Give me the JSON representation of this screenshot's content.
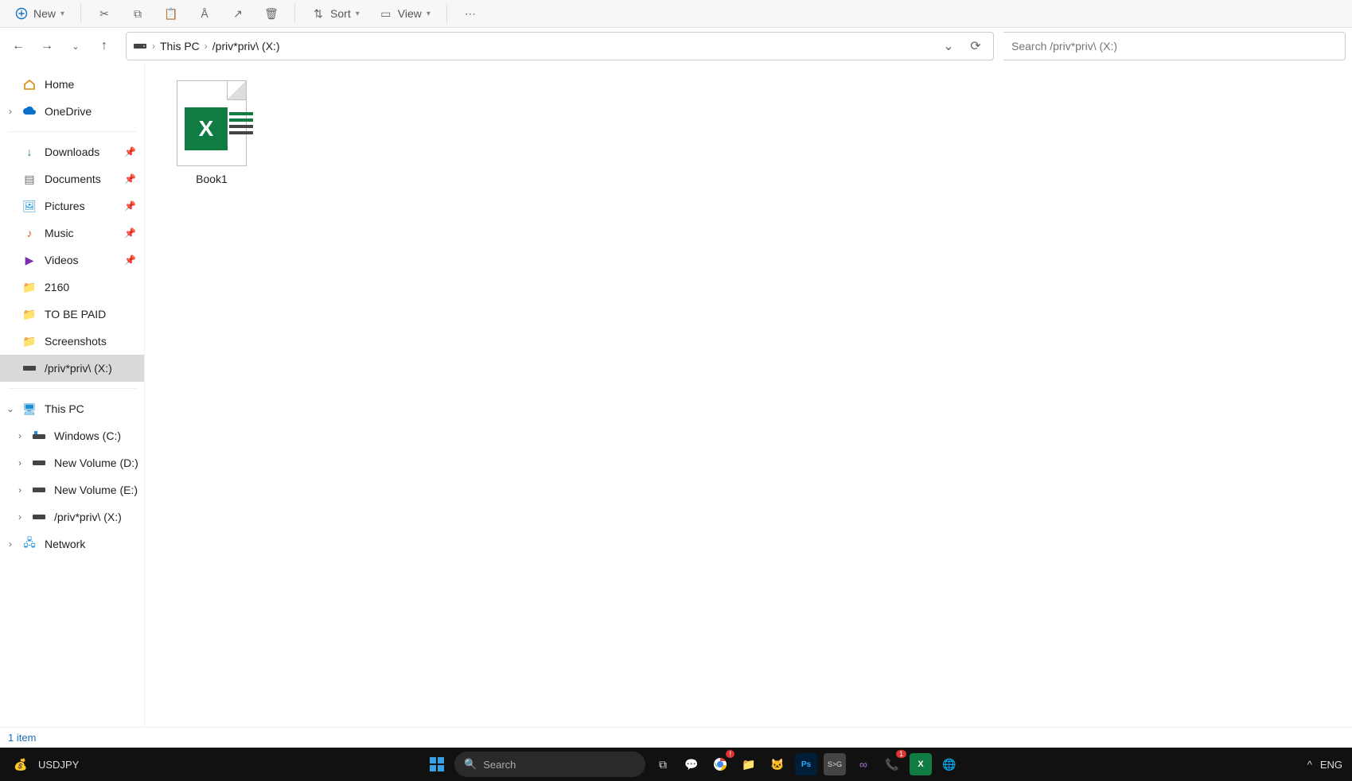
{
  "toolbar": {
    "new_label": "New",
    "sort_label": "Sort",
    "view_label": "View"
  },
  "nav": {
    "breadcrumb": [
      "This PC",
      "/priv*priv\\ (X:)"
    ],
    "search_placeholder": "Search /priv*priv\\ (X:)"
  },
  "sidebar": {
    "home": "Home",
    "onedrive": "OneDrive",
    "quick": [
      {
        "label": "Downloads",
        "icon": "download-icon",
        "cls": "c-down",
        "pinned": true
      },
      {
        "label": "Documents",
        "icon": "document-icon",
        "cls": "c-doc",
        "pinned": true
      },
      {
        "label": "Pictures",
        "icon": "pictures-icon",
        "cls": "c-pic",
        "pinned": true
      },
      {
        "label": "Music",
        "icon": "music-icon",
        "cls": "c-music",
        "pinned": true
      },
      {
        "label": "Videos",
        "icon": "videos-icon",
        "cls": "c-video",
        "pinned": true
      },
      {
        "label": "2160",
        "icon": "folder-icon",
        "cls": "c-folder",
        "pinned": false
      },
      {
        "label": "TO BE PAID",
        "icon": "folder-icon",
        "cls": "c-folder",
        "pinned": false
      },
      {
        "label": "Screenshots",
        "icon": "folder-icon",
        "cls": "c-folder",
        "pinned": false
      },
      {
        "label": "/priv*priv\\ (X:)",
        "icon": "drive-icon",
        "cls": "c-drive",
        "pinned": false,
        "active": true
      }
    ],
    "this_pc": "This PC",
    "drives": [
      {
        "label": "Windows (C:)",
        "icon": "drive-os-icon"
      },
      {
        "label": "New Volume (D:)",
        "icon": "drive-icon"
      },
      {
        "label": "New Volume (E:)",
        "icon": "drive-icon"
      },
      {
        "label": "/priv*priv\\ (X:)",
        "icon": "drive-icon"
      }
    ],
    "network": "Network"
  },
  "files": [
    {
      "name": "Book1",
      "type": "excel"
    }
  ],
  "status": {
    "count_text": "1 item"
  },
  "taskbar": {
    "widget": "USDJPY",
    "search_placeholder": "Search",
    "lang": "ENG"
  }
}
